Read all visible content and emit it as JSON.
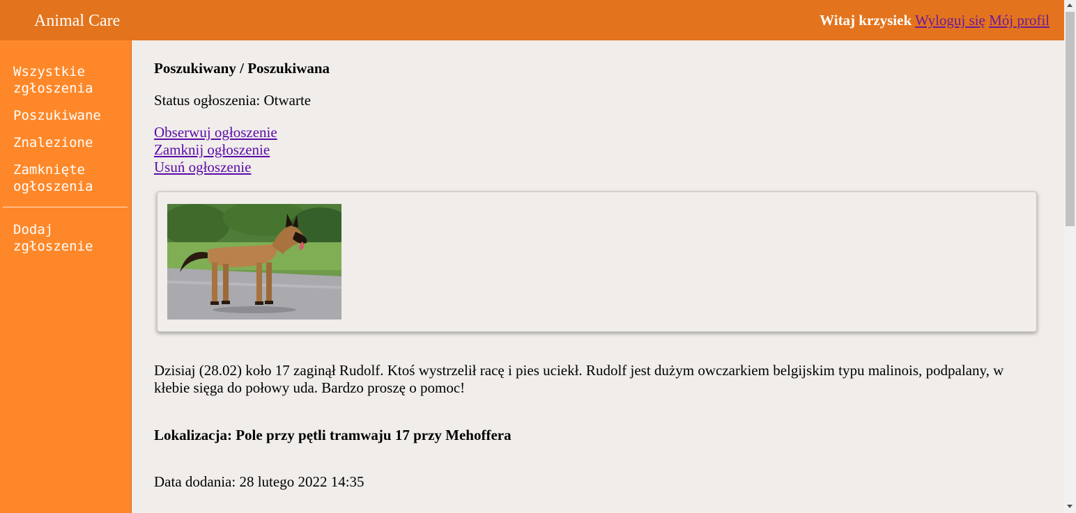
{
  "header": {
    "brand": "Animal Care",
    "greeting": "Witaj krzysiek",
    "logout_label": "Wyloguj się",
    "profile_label": "Mój profil"
  },
  "sidebar": {
    "items": [
      {
        "label": "Wszystkie zgłoszenia"
      },
      {
        "label": "Poszukiwane"
      },
      {
        "label": "Znalezione"
      },
      {
        "label": "Zamknięte ogłoszenia"
      }
    ],
    "add_label": "Dodaj zgłoszenie"
  },
  "listing": {
    "heading": "Poszukiwany / Poszukiwana",
    "status": "Status ogłoszenia: Otwarte",
    "actions": {
      "watch": "Obserwuj ogłoszenie",
      "close": "Zamknij ogłoszenie",
      "delete": "Usuń ogłoszenie"
    },
    "photo_icon": "dog-photo",
    "description": "Dzisiaj (28.02) koło 17 zaginął Rudolf. Ktoś wystrzelił racę i pies uciekł. Rudolf jest dużym owczarkiem belgijskim typu malinois, podpalany, w kłebie sięga do połowy uda. Bardzo proszę o pomoc!",
    "location": "Lokalizacja: Pole przy pętli tramwaju 17 przy Mehoffera",
    "date_added": "Data dodania: 28 lutego 2022 14:35"
  },
  "colors": {
    "header_bg": "#e3741d",
    "sidebar_bg": "#fe8829",
    "content_bg": "#f0edea",
    "link": "#5a0aa8"
  }
}
